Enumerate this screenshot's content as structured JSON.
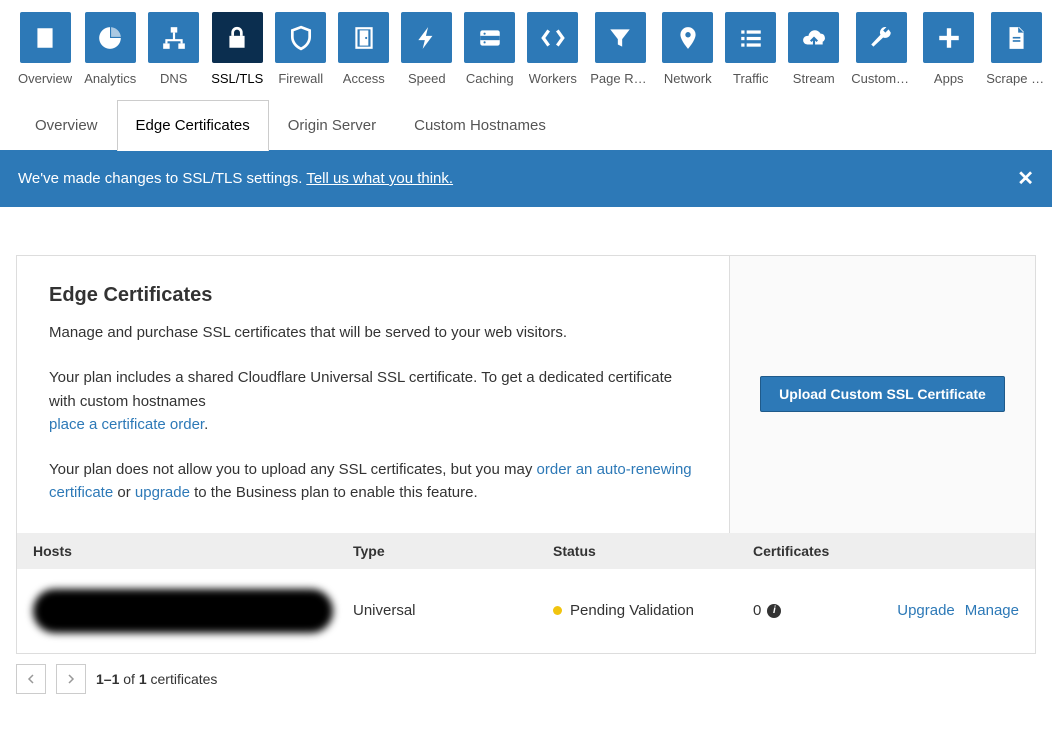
{
  "nav": [
    {
      "label": "Overview",
      "icon": "doc"
    },
    {
      "label": "Analytics",
      "icon": "pie"
    },
    {
      "label": "DNS",
      "icon": "sitemap"
    },
    {
      "label": "SSL/TLS",
      "icon": "lock",
      "active": true
    },
    {
      "label": "Firewall",
      "icon": "shield"
    },
    {
      "label": "Access",
      "icon": "door"
    },
    {
      "label": "Speed",
      "icon": "bolt"
    },
    {
      "label": "Caching",
      "icon": "server"
    },
    {
      "label": "Workers",
      "icon": "brackets"
    },
    {
      "label": "Page Rules",
      "icon": "funnel"
    },
    {
      "label": "Network",
      "icon": "pin"
    },
    {
      "label": "Traffic",
      "icon": "list"
    },
    {
      "label": "Stream",
      "icon": "cloud"
    },
    {
      "label": "Custom P…",
      "icon": "wrench"
    },
    {
      "label": "Apps",
      "icon": "plus"
    },
    {
      "label": "Scrape S…",
      "icon": "page"
    }
  ],
  "tabs": [
    {
      "label": "Overview"
    },
    {
      "label": "Edge Certificates",
      "active": true
    },
    {
      "label": "Origin Server"
    },
    {
      "label": "Custom Hostnames"
    }
  ],
  "banner": {
    "text": "We've made changes to SSL/TLS settings. ",
    "link": "Tell us what you think.",
    "close": "✕"
  },
  "card": {
    "title": "Edge Certificates",
    "p1": "Manage and purchase SSL certificates that will be served to your web visitors.",
    "p2a": "Your plan includes a shared Cloudflare Universal SSL certificate. To get a dedicated certificate with custom hostnames",
    "p2link": "place a certificate order",
    "p2b": ".",
    "p3a": "Your plan does not allow you to upload any SSL certificates, but you may ",
    "p3link1": "order an auto-renewing certificate",
    "p3b": " or ",
    "p3link2": "upgrade",
    "p3c": " to the Business plan to enable this feature.",
    "button": "Upload Custom SSL Certificate"
  },
  "table": {
    "headers": {
      "hosts": "Hosts",
      "type": "Type",
      "status": "Status",
      "certs": "Certificates"
    },
    "row": {
      "type": "Universal",
      "status": "Pending Validation",
      "certs": "0",
      "upgrade": "Upgrade",
      "manage": "Manage"
    }
  },
  "pagination": {
    "text_prefix": "1–1",
    "text_mid": " of ",
    "text_bold": "1",
    "text_suffix": " certificates"
  }
}
